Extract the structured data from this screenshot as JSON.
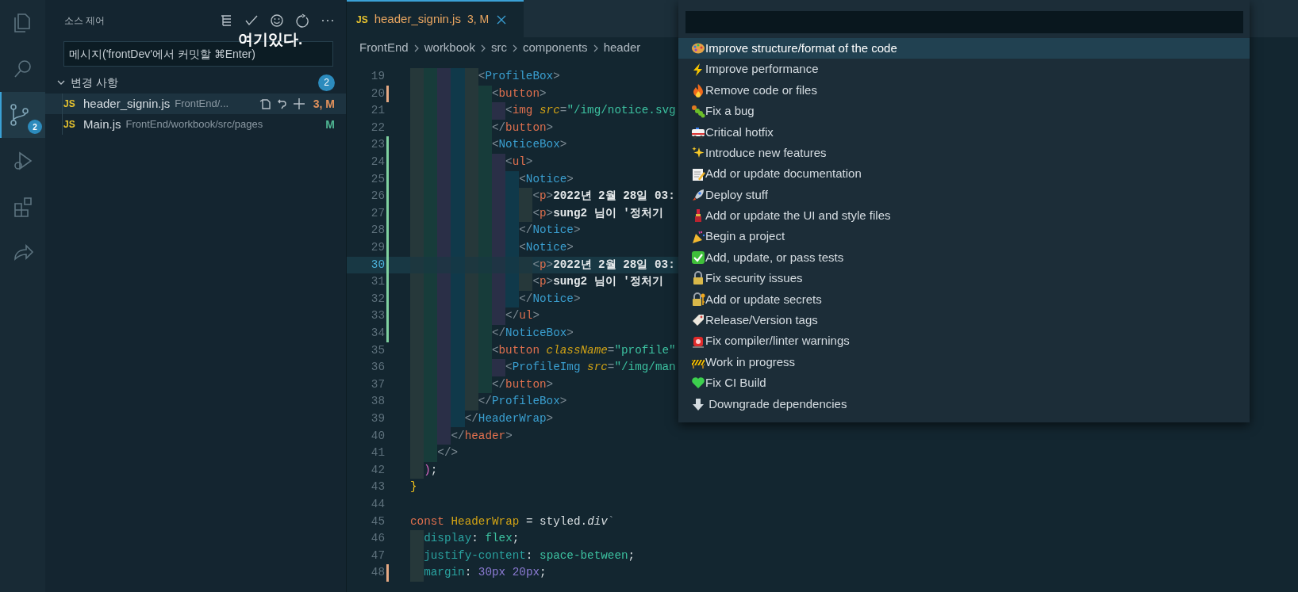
{
  "activity_bar": {
    "source_control_badge": "2"
  },
  "sidebar": {
    "title": "소스 제어",
    "annotation": "여기있다.",
    "message_field": {
      "placeholder": "메시지('frontDev'에서 커밋할 ⌘Enter)"
    },
    "changes": {
      "label": "변경 사항",
      "count": "2",
      "expanded": true
    },
    "files": [
      {
        "type_badge": "JS",
        "name": "header_signin.js",
        "path": "FrontEnd/...",
        "status": "3, M",
        "color": "#e2925c",
        "selected": true
      },
      {
        "type_badge": "JS",
        "name": "Main.js",
        "path": "FrontEnd/workbook/src/pages",
        "status": "M",
        "color": "#4fb592",
        "selected": false
      }
    ]
  },
  "tabs": [
    {
      "type_badge": "JS",
      "label": "header_signin.js",
      "status": "3, M",
      "selected": true
    }
  ],
  "breadcrumbs": [
    "FrontEnd",
    "workbook",
    "src",
    "components",
    "header"
  ],
  "code_lines": [
    {
      "number": "19",
      "added": false,
      "modified": false,
      "current": false,
      "text": "          <ProfileBox>"
    },
    {
      "number": "20",
      "added": false,
      "modified": true,
      "current": false,
      "text": "            <button>"
    },
    {
      "number": "21",
      "added": false,
      "modified": false,
      "current": false,
      "text": "              <img src=\"/img/notice.svg"
    },
    {
      "number": "22",
      "added": false,
      "modified": false,
      "current": false,
      "text": "            </button>"
    },
    {
      "number": "23",
      "added": true,
      "modified": false,
      "current": false,
      "text": "            <NoticeBox>"
    },
    {
      "number": "24",
      "added": true,
      "modified": false,
      "current": false,
      "text": "              <ul>"
    },
    {
      "number": "25",
      "added": true,
      "modified": false,
      "current": false,
      "text": "                <Notice>"
    },
    {
      "number": "26",
      "added": true,
      "modified": false,
      "current": false,
      "text": "                  <p>2022년 2월 28일 03:"
    },
    {
      "number": "27",
      "added": true,
      "modified": false,
      "current": false,
      "text": "                  <p>sung2 님이 '정처기"
    },
    {
      "number": "28",
      "added": true,
      "modified": false,
      "current": false,
      "text": "                </Notice>"
    },
    {
      "number": "29",
      "added": true,
      "modified": false,
      "current": false,
      "text": "                <Notice>"
    },
    {
      "number": "30",
      "added": true,
      "modified": false,
      "current": true,
      "text": "                  <p>2022년 2월 28일 03:"
    },
    {
      "number": "31",
      "added": true,
      "modified": false,
      "current": false,
      "text": "                  <p>sung2 님이 '정처기"
    },
    {
      "number": "32",
      "added": true,
      "modified": false,
      "current": false,
      "text": "                </Notice>"
    },
    {
      "number": "33",
      "added": true,
      "modified": false,
      "current": false,
      "text": "              </ul>"
    },
    {
      "number": "34",
      "added": true,
      "modified": false,
      "current": false,
      "text": "            </NoticeBox>"
    },
    {
      "number": "35",
      "added": false,
      "modified": false,
      "current": false,
      "text": "            <button className=\"profile\""
    },
    {
      "number": "36",
      "added": false,
      "modified": false,
      "current": false,
      "text": "              <ProfileImg src=\"/img/man"
    },
    {
      "number": "37",
      "added": false,
      "modified": false,
      "current": false,
      "text": "            </button>"
    },
    {
      "number": "38",
      "added": false,
      "modified": false,
      "current": false,
      "text": "          </ProfileBox>"
    },
    {
      "number": "39",
      "added": false,
      "modified": false,
      "current": false,
      "text": "        </HeaderWrap>"
    },
    {
      "number": "40",
      "added": false,
      "modified": false,
      "current": false,
      "text": "      </header>"
    },
    {
      "number": "41",
      "added": false,
      "modified": false,
      "current": false,
      "text": "    </>"
    },
    {
      "number": "42",
      "added": false,
      "modified": false,
      "current": false,
      "text": "  );"
    },
    {
      "number": "43",
      "added": false,
      "modified": false,
      "current": false,
      "text": "}"
    },
    {
      "number": "44",
      "added": false,
      "modified": false,
      "current": false
    },
    {
      "number": "45",
      "added": false,
      "modified": false,
      "current": false,
      "text": "const HeaderWrap = styled.div`"
    },
    {
      "number": "46",
      "added": false,
      "modified": false,
      "current": false,
      "text": "  display: flex;"
    },
    {
      "number": "47",
      "added": false,
      "modified": false,
      "current": false,
      "text": "  justify-content: space-between;"
    },
    {
      "number": "48",
      "added": false,
      "modified": true,
      "current": false,
      "text": "  margin: 30px 20px;"
    }
  ],
  "quick_pick": {
    "items": [
      {
        "label": "Improve structure/format of the code",
        "selected": true
      },
      {
        "label": "Improve performance",
        "selected": false
      },
      {
        "label": "Remove code or files",
        "selected": false
      },
      {
        "label": "Fix a bug",
        "selected": false
      },
      {
        "label": "Critical hotfix",
        "selected": false
      },
      {
        "label": "Introduce new features",
        "selected": false
      },
      {
        "label": "Add or update documentation",
        "selected": false
      },
      {
        "label": "Deploy stuff",
        "selected": false
      },
      {
        "label": "Add or update the UI and style files",
        "selected": false
      },
      {
        "label": "Begin a project",
        "selected": false
      },
      {
        "label": "Add, update, or pass tests",
        "selected": false
      },
      {
        "label": "Fix security issues",
        "selected": false
      },
      {
        "label": "Add or update secrets",
        "selected": false
      },
      {
        "label": "Release/Version tags",
        "selected": false
      },
      {
        "label": "Fix compiler/linter warnings",
        "selected": false
      },
      {
        "label": "Work in progress",
        "selected": false
      },
      {
        "label": "Fix CI Build",
        "selected": false
      },
      {
        "label": " Downgrade dependencies",
        "selected": false
      }
    ]
  }
}
